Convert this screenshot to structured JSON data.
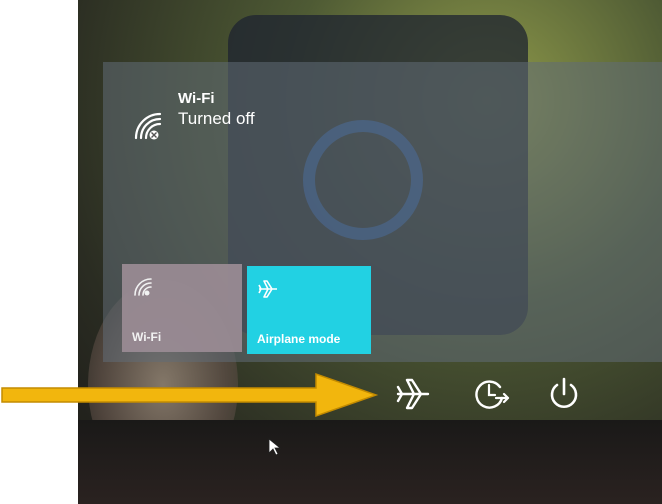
{
  "wifi_status": {
    "title": "Wi-Fi",
    "subtitle": "Turned off"
  },
  "tiles": [
    {
      "label": "Wi-Fi",
      "icon": "wifi-icon",
      "active": false
    },
    {
      "label": "Airplane mode",
      "icon": "airplane-icon",
      "active": true
    }
  ],
  "system_icons": [
    "airplane-icon",
    "clock-arrow-icon",
    "power-icon"
  ],
  "colors": {
    "arrow": "#f2b60d",
    "airplane_tile": "#22d1e3",
    "wifi_tile": "#9b8c95"
  }
}
